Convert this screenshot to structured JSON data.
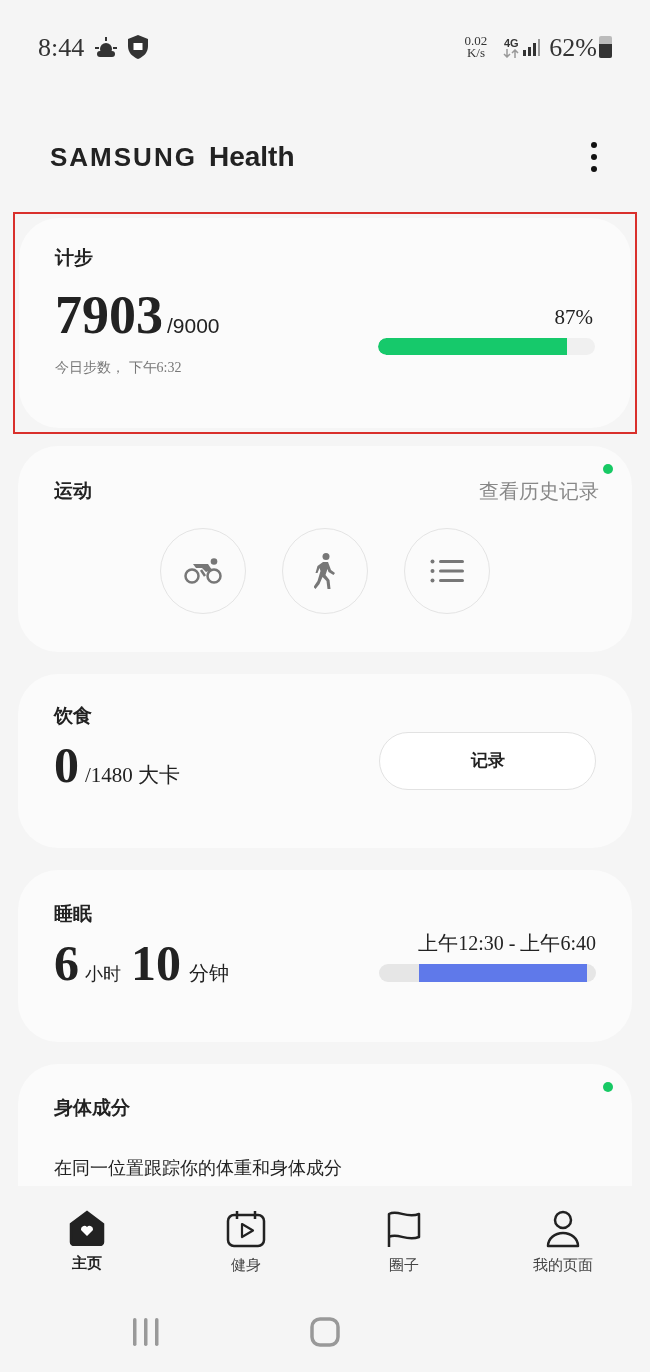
{
  "status_bar": {
    "time": "8:44",
    "net_speed_value": "0.02",
    "net_speed_unit": "K/s",
    "network": "4G",
    "battery": "62%"
  },
  "header": {
    "brand": "SAMSUNG",
    "product": "Health"
  },
  "steps": {
    "title": "计步",
    "count": "7903",
    "goal": "/9000",
    "percent": "87%",
    "level": 0.87,
    "note": "今日步数， 下午6:32",
    "highlighted": true
  },
  "exercise": {
    "title": "运动",
    "history_link": "查看历史记录",
    "new_dot": true,
    "shortcuts": [
      {
        "kind": "cycling"
      },
      {
        "kind": "walking"
      },
      {
        "kind": "list"
      }
    ]
  },
  "food": {
    "title": "饮食",
    "value": "0",
    "goal": "/1480 大卡",
    "button": "记录"
  },
  "sleep": {
    "title": "睡眠",
    "hours": "6",
    "hours_unit": "小时",
    "minutes": "10",
    "minutes_unit": "分钟",
    "range": "上午12:30 - 上午6:40"
  },
  "body": {
    "title": "身体成分",
    "new_dot": true,
    "description": "在同一位置跟踪你的体重和身体成分"
  },
  "nav": [
    {
      "label": "主页",
      "kind": "home",
      "selected": true
    },
    {
      "label": "健身",
      "kind": "fitness",
      "selected": false
    },
    {
      "label": "圈子",
      "kind": "together",
      "selected": false
    },
    {
      "label": "我的页面",
      "kind": "profile",
      "selected": false
    }
  ]
}
